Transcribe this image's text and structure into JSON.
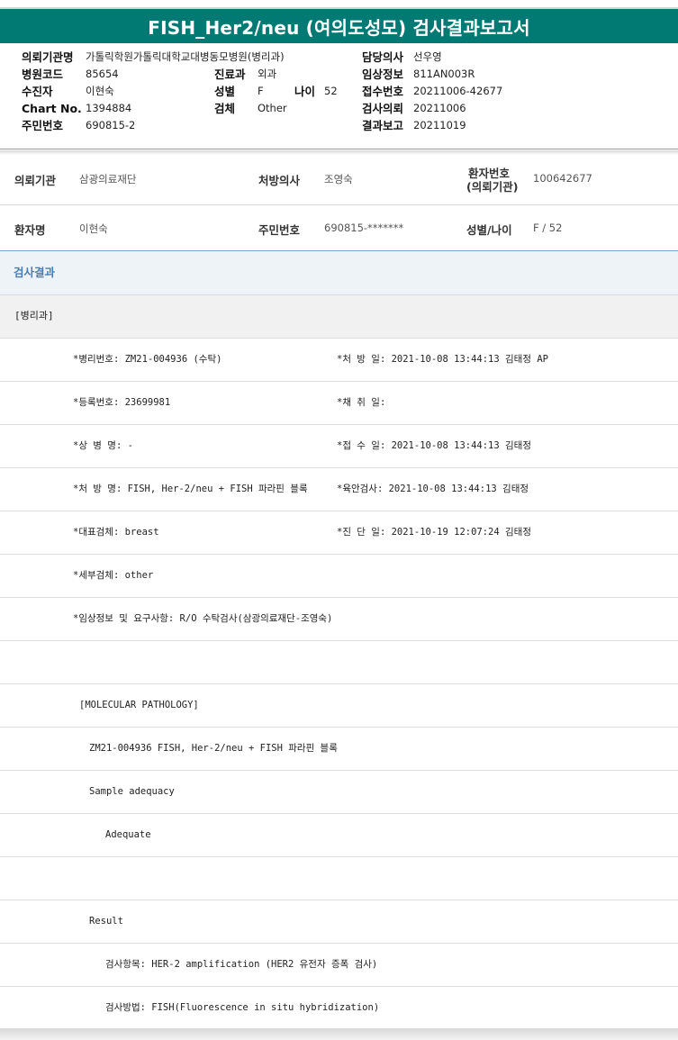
{
  "title": "FISH_Her2/neu (여의도성모) 검사결과보고서",
  "header": {
    "left": [
      {
        "label": "의뢰기관명",
        "value": "가톨릭학원가톨릭대학교대병동모병원(병리과)"
      },
      {
        "label": "병원코드",
        "value": "85654"
      },
      {
        "label": "수진자",
        "value": "이현숙"
      },
      {
        "label": "Chart No.",
        "value": "1394884"
      },
      {
        "label": "주민번호",
        "value": "690815-2"
      }
    ],
    "middle": [
      {
        "label": "진료과",
        "value": "외과"
      },
      {
        "label": "성별",
        "value": "F"
      },
      {
        "label": "검체",
        "value": "Other"
      }
    ],
    "age": {
      "label": "나이",
      "value": "52"
    },
    "right": [
      {
        "label": "담당의사",
        "value": "선우영"
      },
      {
        "label": "임상정보",
        "value": "811AN003R"
      },
      {
        "label": "접수번호",
        "value": "20211006-42677"
      },
      {
        "label": "검사의뢰",
        "value": "20211006"
      },
      {
        "label": "결과보고",
        "value": "20211019"
      }
    ]
  },
  "info": {
    "row1": {
      "institution_label": "의뢰기관",
      "institution": "삼광의료재단",
      "doctor_label": "처방의사",
      "doctor": "조영숙",
      "patient_no_label_1": "환자번호",
      "patient_no_label_2": "(의뢰기관)",
      "patient_no": "100642677"
    },
    "row2": {
      "name_label": "환자명",
      "name": "이현숙",
      "rrn_label": "주민번호",
      "rrn": "690815-*******",
      "sexage_label": "성별/나이",
      "sexage": "F / 52"
    }
  },
  "section_title": "검사결과",
  "department": "[병리과]",
  "rows": [
    {
      "left": "*병리번호: ZM21-004936 (수탁)",
      "right": "*처 방 일: 2021-10-08 13:44:13  김태정 AP"
    },
    {
      "left": "*등록번호: 23699981",
      "right": "*채 취 일:"
    },
    {
      "left": "*상 병 명: -",
      "right": "*접 수 일: 2021-10-08 13:44:13  김태정"
    },
    {
      "left": "*처 방 명: FISH, Her-2/neu + FISH 파라핀 블록",
      "right": "*육안검사: 2021-10-08 13:44:13  김태정"
    },
    {
      "left": "*대표검체: breast",
      "right": "*진 단 일: 2021-10-19 12:07:24  김태정"
    },
    {
      "left": "*세부검체: other",
      "right": ""
    },
    {
      "left": "*임상정보 및 요구사항: R/O 수탁검사(삼광의료재단-조영숙)",
      "right": ""
    }
  ],
  "report": [
    {
      "text": "",
      "indent": 0
    },
    {
      "text": "[MOLECULAR PATHOLOGY]",
      "indent": 1
    },
    {
      "text": "ZM21-004936     FISH, Her-2/neu + FISH 파라핀 블록",
      "indent": 2
    },
    {
      "text": "Sample adequacy",
      "indent": 2
    },
    {
      "text": "Adequate",
      "indent": 3
    },
    {
      "text": "",
      "indent": 0
    },
    {
      "text": "Result",
      "indent": 2
    },
    {
      "text": "검사항목: HER-2 amplification (HER2 유전자 증폭 검사)",
      "indent": 3
    },
    {
      "text": "검사방법: FISH(Fluorescence in situ hybridization)",
      "indent": 3
    }
  ]
}
